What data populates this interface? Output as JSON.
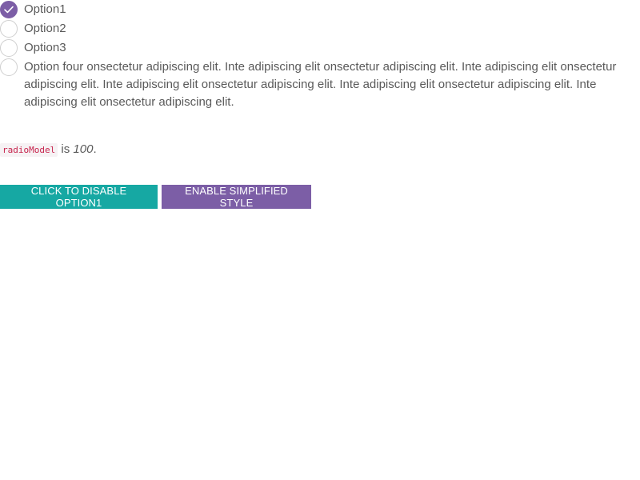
{
  "options": [
    {
      "label": "Option1",
      "checked": true
    },
    {
      "label": "Option2",
      "checked": false
    },
    {
      "label": "Option3",
      "checked": false
    },
    {
      "label": "Option four onsectetur adipiscing elit. Inte adipiscing elit onsectetur adipiscing elit. Inte adipiscing elit onsectetur adipiscing elit. Inte adipiscing elit onsectetur adipiscing elit. Inte adipiscing elit onsectetur adipiscing elit. Inte adipiscing elit onsectetur adipiscing elit.",
      "checked": false
    }
  ],
  "model": {
    "name": "radioModel",
    "connector": "is",
    "value": "100",
    "suffix": "."
  },
  "buttons": {
    "disable_label": "CLICK TO DISABLE OPTION1",
    "simplified_label": "ENABLE SIMPLIFIED STYLE"
  },
  "colors": {
    "accent": "#7c5ea6",
    "teal": "#16a8a3",
    "code": "#c7254e"
  },
  "icons": {
    "checked": "checkmark-icon"
  }
}
